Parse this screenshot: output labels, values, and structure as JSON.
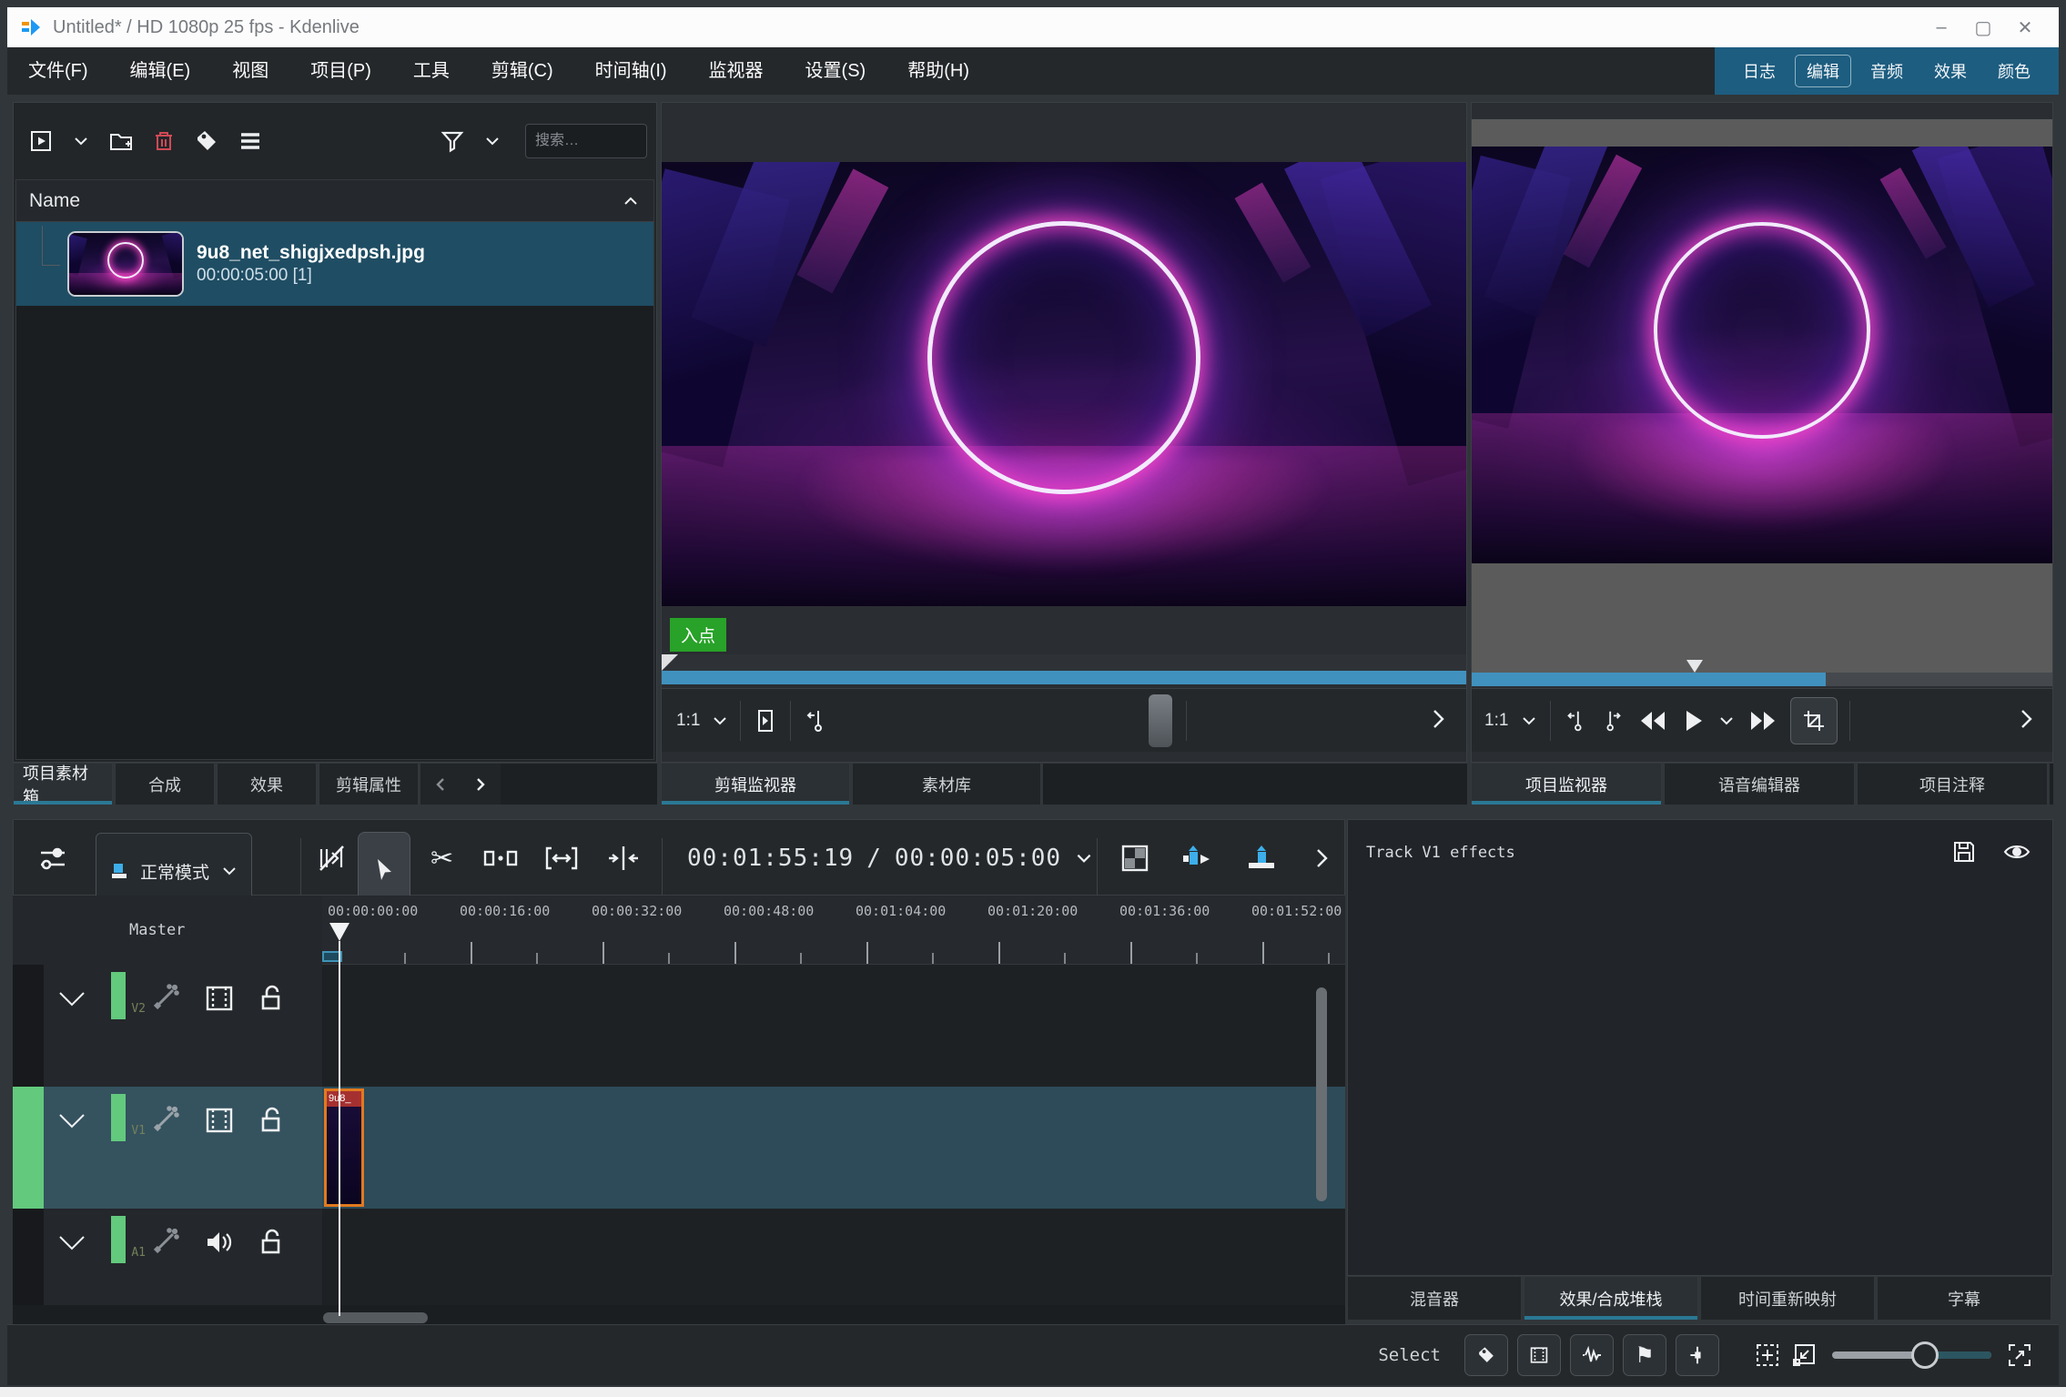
{
  "window": {
    "title": "Untitled* / HD 1080p 25 fps - Kdenlive",
    "controls": {
      "minimize": "–",
      "maximize": "▢",
      "close": "✕"
    }
  },
  "menu": {
    "items": [
      "文件(F)",
      "编辑(E)",
      "视图",
      "项目(P)",
      "工具",
      "剪辑(C)",
      "时间轴(I)",
      "监视器",
      "设置(S)",
      "帮助(H)"
    ]
  },
  "workspaces": {
    "items": [
      "日志",
      "编辑",
      "音频",
      "效果",
      "颜色"
    ],
    "active": "编辑"
  },
  "bin": {
    "search_placeholder": "搜索…",
    "column_header": "Name",
    "clip": {
      "name": "9u8_net_shigjxedpsh.jpg",
      "duration": "00:00:05:00 [1]"
    },
    "tabs": [
      "项目素材箱",
      "合成",
      "效果",
      "剪辑属性"
    ],
    "active_tab": "项目素材箱"
  },
  "clip_monitor": {
    "zoom_level": "1:1",
    "in_point_label": "入点",
    "tabs": [
      "剪辑监视器",
      "素材库"
    ],
    "active_tab": "剪辑监视器"
  },
  "project_monitor": {
    "zoom_level": "1:1",
    "tabs": [
      "项目监视器",
      "语音编辑器",
      "项目注释"
    ],
    "active_tab": "项目监视器"
  },
  "timeline_toolbar": {
    "mode_label": "正常模式",
    "timecode_current": "00:01:55:19",
    "timecode_separator": "/",
    "timecode_total": "00:00:05:00"
  },
  "timeline": {
    "master_label": "Master",
    "ruler_ticks": [
      "00:00:00:00",
      "00:00:16:00",
      "00:00:32:00",
      "00:00:48:00",
      "00:01:04:00",
      "00:01:20:00",
      "00:01:36:00",
      "00:01:52:00"
    ],
    "tracks": [
      {
        "name": "V2"
      },
      {
        "name": "V1"
      },
      {
        "name": "A1"
      }
    ],
    "selected_track": "V1",
    "clip_label": "9u8_"
  },
  "effects_panel": {
    "title": "Track V1 effects",
    "tabs": [
      "混音器",
      "效果/合成堆栈",
      "时间重新映射",
      "字幕"
    ],
    "active_tab": "效果/合成堆栈"
  },
  "status_bar": {
    "select_label": "Select"
  },
  "glyphs": {
    "scissors": "✂",
    "flag": "⚑"
  },
  "colors": {
    "accent": "#3daee9",
    "workspace_header": "#1d5d80",
    "bin_selection": "#1f4d63",
    "seekbar_blue": "#4191be",
    "in_point_green": "#28a228",
    "clip_border_orange": "#e07a1f",
    "track_target_green": "#62c97d",
    "tab_underline": "#2a7894"
  }
}
